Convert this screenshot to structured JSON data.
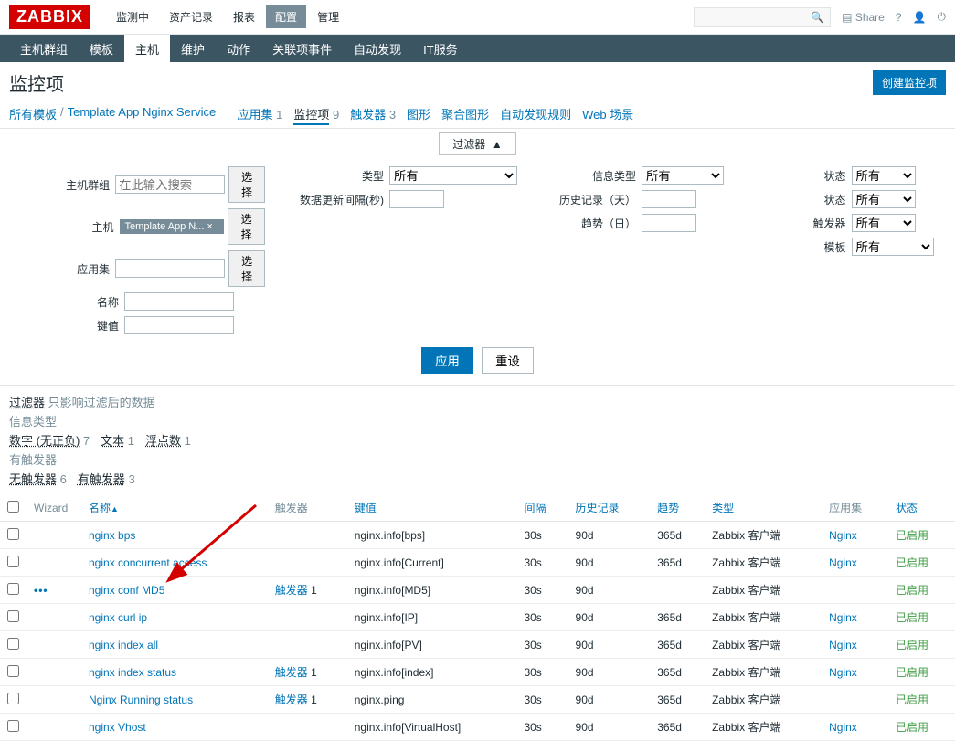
{
  "logo": "ZABBIX",
  "topnav": [
    "监测中",
    "资产记录",
    "报表",
    "配置",
    "管理"
  ],
  "topnav_active": 3,
  "topright": {
    "share": "Share",
    "help": "?",
    "user": "👤",
    "power": "⏻"
  },
  "subnav": [
    "主机群组",
    "模板",
    "主机",
    "维护",
    "动作",
    "关联项事件",
    "自动发现",
    "IT服务"
  ],
  "subnav_active": 2,
  "page_title": "监控项",
  "create_btn": "创建监控项",
  "crumbs": {
    "all_templates": "所有模板",
    "template_name": "Template App Nginx Service",
    "tabs": [
      {
        "label": "应用集",
        "count": "1"
      },
      {
        "label": "监控项",
        "count": "9",
        "active": true
      },
      {
        "label": "触发器",
        "count": "3"
      },
      {
        "label": "图形",
        "count": ""
      },
      {
        "label": "聚合图形",
        "count": ""
      },
      {
        "label": "自动发现规则",
        "count": ""
      },
      {
        "label": "Web 场景",
        "count": ""
      }
    ]
  },
  "filter_label": "过滤器",
  "filter": {
    "col1": {
      "hostgroup_label": "主机群组",
      "hostgroup_placeholder": "在此输入搜索",
      "select_btn": "选择",
      "host_label": "主机",
      "host_tag": "Template App N...  ×",
      "appset_label": "应用集",
      "name_label": "名称",
      "key_label": "键值"
    },
    "col2": {
      "type_label": "类型",
      "type_val": "所有",
      "update_label": "数据更新间隔(秒)"
    },
    "col3": {
      "infotype_label": "信息类型",
      "infotype_val": "所有",
      "history_label": "历史记录（天）",
      "trend_label": "趋势（日）"
    },
    "col4": {
      "state_label": "状态",
      "state_val": "所有",
      "status_label": "状态",
      "status_val": "所有",
      "trigger_label": "触发器",
      "trigger_val": "所有",
      "template_label": "模板",
      "template_val": "所有"
    },
    "apply": "应用",
    "reset": "重设"
  },
  "subfilter": {
    "header": "过滤器",
    "note": "只影响过滤后的数据",
    "row1_label": "信息类型",
    "row1_items": [
      {
        "t": "数字 (无正负)",
        "c": "7"
      },
      {
        "t": "文本",
        "c": "1"
      },
      {
        "t": "浮点数",
        "c": "1"
      }
    ],
    "row2_label": "有触发器",
    "row2_items": [
      {
        "t": "无触发器",
        "c": "6"
      },
      {
        "t": "有触发器",
        "c": "3"
      }
    ]
  },
  "table": {
    "cols": [
      "",
      "Wizard",
      "名称",
      "触发器",
      "键值",
      "间隔",
      "历史记录",
      "趋势",
      "类型",
      "应用集",
      "状态"
    ],
    "sort_col": 2,
    "rows": [
      {
        "wiz": "",
        "name": "nginx bps",
        "trig": "",
        "key": "nginx.info[bps]",
        "int": "30s",
        "hist": "90d",
        "trend": "365d",
        "type": "Zabbix 客户端",
        "app": "Nginx",
        "status": "已启用"
      },
      {
        "wiz": "",
        "name": "nginx concurrent access",
        "trig": "",
        "key": "nginx.info[Current]",
        "int": "30s",
        "hist": "90d",
        "trend": "365d",
        "type": "Zabbix 客户端",
        "app": "Nginx",
        "status": "已启用"
      },
      {
        "wiz": "•••",
        "name": "nginx conf MD5",
        "trig": "触发器 1",
        "key": "nginx.info[MD5]",
        "int": "30s",
        "hist": "90d",
        "trend": "",
        "type": "Zabbix 客户端",
        "app": "",
        "status": "已启用"
      },
      {
        "wiz": "",
        "name": "nginx curl ip",
        "trig": "",
        "key": "nginx.info[IP]",
        "int": "30s",
        "hist": "90d",
        "trend": "365d",
        "type": "Zabbix 客户端",
        "app": "Nginx",
        "status": "已启用"
      },
      {
        "wiz": "",
        "name": "nginx index all",
        "trig": "",
        "key": "nginx.info[PV]",
        "int": "30s",
        "hist": "90d",
        "trend": "365d",
        "type": "Zabbix 客户端",
        "app": "Nginx",
        "status": "已启用"
      },
      {
        "wiz": "",
        "name": "nginx index status",
        "trig": "触发器 1",
        "key": "nginx.info[index]",
        "int": "30s",
        "hist": "90d",
        "trend": "365d",
        "type": "Zabbix 客户端",
        "app": "Nginx",
        "status": "已启用"
      },
      {
        "wiz": "",
        "name": "Nginx Running status",
        "trig": "触发器 1",
        "key": "nginx.ping",
        "int": "30s",
        "hist": "90d",
        "trend": "365d",
        "type": "Zabbix 客户端",
        "app": "",
        "status": "已启用"
      },
      {
        "wiz": "",
        "name": "nginx Vhost",
        "trig": "",
        "key": "nginx.info[VirtualHost]",
        "int": "30s",
        "hist": "90d",
        "trend": "365d",
        "type": "Zabbix 客户端",
        "app": "Nginx",
        "status": "已启用"
      }
    ]
  }
}
